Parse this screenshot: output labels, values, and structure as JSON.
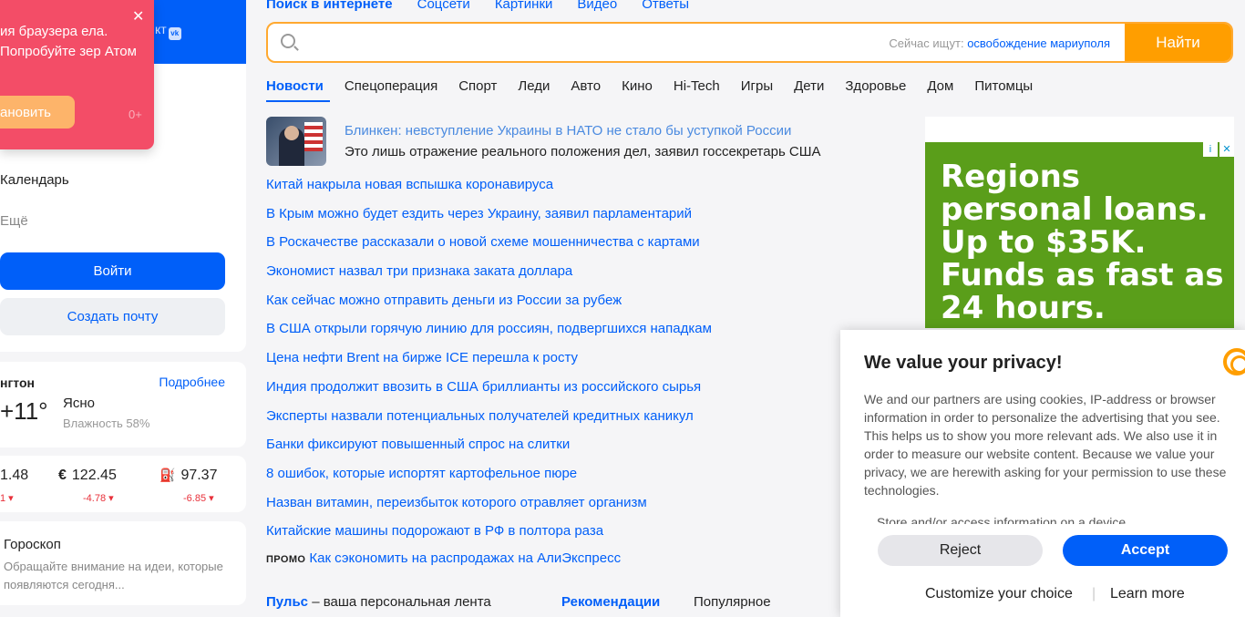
{
  "left": {
    "vk_link": "кт",
    "toast": {
      "text": "ия браузера ела. Попробуйте зер Атом",
      "button": "ановить",
      "age": "0+",
      "close": "✕"
    },
    "menu": {
      "calendar": "Календарь",
      "more": "Ещё"
    },
    "login_button": "Войти",
    "create_mail_button": "Создать почту",
    "weather": {
      "city": "нгтон",
      "more": "Подробнее",
      "temp": "+11°",
      "condition": "Ясно",
      "humidity": "Влажность 58%"
    },
    "rates": [
      {
        "icon": "",
        "value": "1.48",
        "change": "1 ▾"
      },
      {
        "icon": "€",
        "value": "122.45",
        "change": "-4.78 ▾"
      },
      {
        "icon": "⛽",
        "value": "97.37",
        "change": "-6.85 ▾"
      }
    ],
    "horoscope": {
      "title": "Гороскоп",
      "text": "Обращайте внимание на идеи, которые появляются сегодня..."
    }
  },
  "search": {
    "tabs": [
      "Поиск в интернете",
      "Соцсети",
      "Картинки",
      "Видео",
      "Ответы"
    ],
    "hint_prefix": "Сейчас ищут:",
    "hint_link": "освобождение мариуполя",
    "button": "Найти"
  },
  "news": {
    "tabs": [
      "Новости",
      "Спецоперация",
      "Спорт",
      "Леди",
      "Авто",
      "Кино",
      "Hi-Tech",
      "Игры",
      "Дети",
      "Здоровье",
      "Дом",
      "Питомцы"
    ],
    "headline_title": "Блинкен: невступление Украины в НАТО не стало бы уступкой России",
    "headline_sub": "Это лишь отражение реального положения дел, заявил госсекретарь США",
    "items": [
      "Китай накрыла новая вспышка коронавируса",
      "В Крым можно будет ездить через Украину, заявил парламентарий",
      "В Роскачестве рассказали о новой схеме мошенничества с картами",
      "Экономист назвал три признака заката доллара",
      "Как сейчас можно отправить деньги из России за рубеж",
      "В США открыли горячую линию для россиян, подвергшихся нападкам",
      "Цена нефти Brent на бирже ICE перешла к росту",
      "Индия продолжит ввозить в США бриллианты из российского сырья",
      "Эксперты назвали потенциальных получателей кредитных каникул",
      "Банки фиксируют повышенный спрос на слитки",
      "8 ошибок, которые испортят картофельное пюре",
      "Назван витамин, переизбыток которого отравляет организм",
      "Китайские машины подорожают в РФ в полтора раза"
    ],
    "promo_tag": "ПРОМО",
    "promo_link": "Как сэкономить на распродажах на АлиЭкспресс",
    "pulse": "Пульс",
    "pulse_rest": " – ваша персональная лента",
    "recommendations": "Рекомендации",
    "popular": "Популярное"
  },
  "ad": {
    "text": "Regions personal loans. Up to $35K. Funds as fast as 24 hours.",
    "info_icon": "i",
    "close_icon": "✕"
  },
  "privacy": {
    "title": "We value your privacy!",
    "body": "We and our partners are using cookies, IP-address or browser information in order to personalize the advertising that you see. This helps us to show you more relevant ads. We also use it in order to measure our website content. Because we value your privacy, we are herewith asking for your permission to use these technologies.",
    "store": "Store and/or access information on a device",
    "reject": "Reject",
    "accept": "Accept",
    "customize": "Customize your choice",
    "separator": "|",
    "learn_more": "Learn more"
  }
}
